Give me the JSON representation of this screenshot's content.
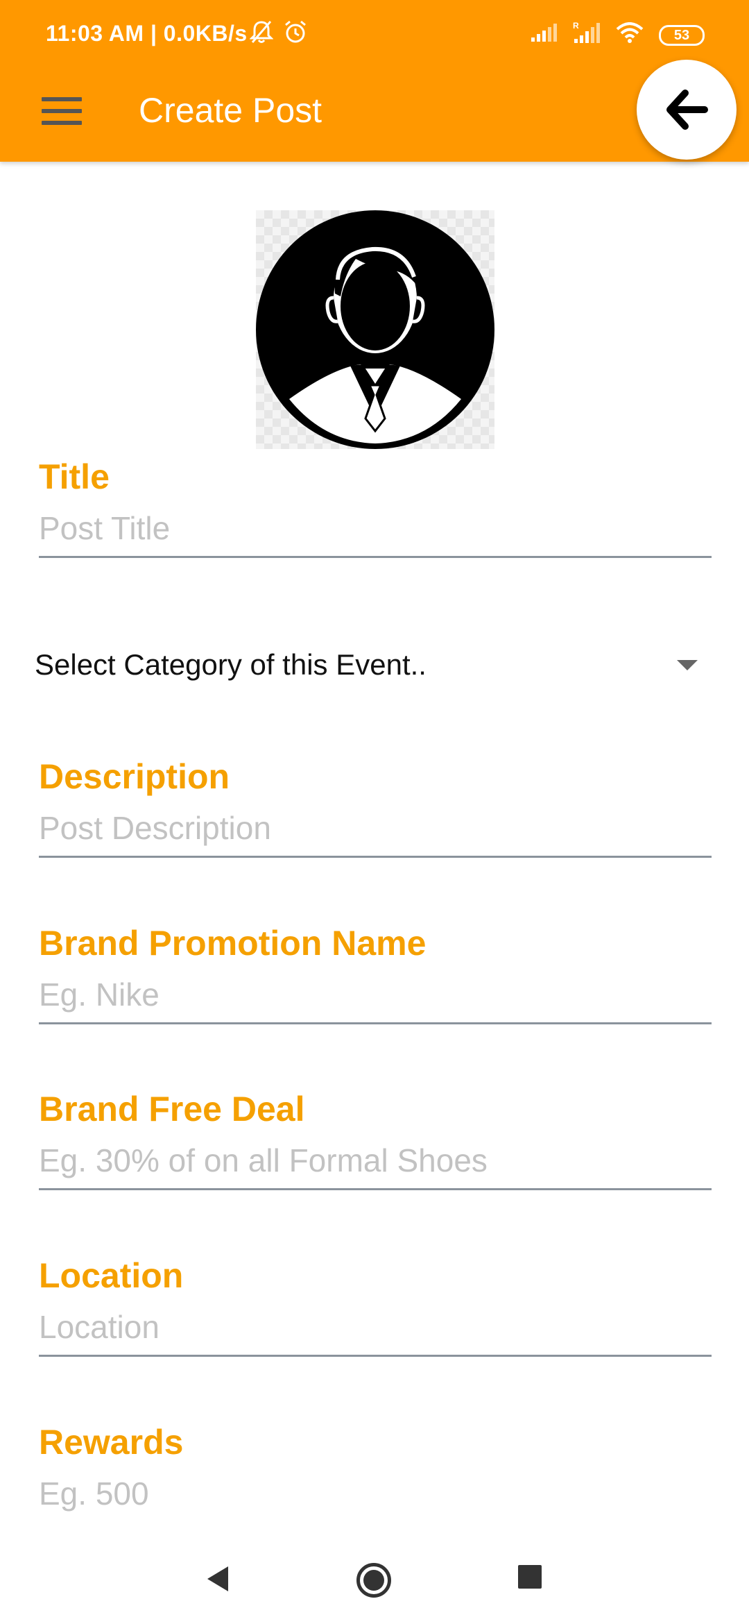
{
  "status_bar": {
    "time": "11:03 AM | 0.0KB/s",
    "battery": "53",
    "icons": [
      "bell-off-icon",
      "alarm-icon",
      "signal-icon",
      "signal-roaming-icon",
      "wifi-icon",
      "battery-icon"
    ]
  },
  "app_bar": {
    "title": "Create Post",
    "menu_icon": "hamburger-menu-icon",
    "back_icon": "arrow-left-icon"
  },
  "avatar": {
    "icon": "user-avatar-icon"
  },
  "form": {
    "title": {
      "label": "Title",
      "placeholder": "Post Title"
    },
    "category": {
      "selected": "Select Category of this Event.."
    },
    "description": {
      "label": "Description",
      "placeholder": "Post Description"
    },
    "brand_promotion": {
      "label": "Brand Promotion Name",
      "placeholder": "Eg. Nike"
    },
    "brand_deal": {
      "label": "Brand Free Deal",
      "placeholder": "Eg. 30% of on all Formal Shoes"
    },
    "location": {
      "label": "Location",
      "placeholder": "Location"
    },
    "rewards": {
      "label": "Rewards",
      "placeholder": "Eg. 500"
    }
  },
  "nav_bar": {
    "icons": [
      "nav-back-icon",
      "nav-home-icon",
      "nav-recents-icon"
    ]
  },
  "colors": {
    "primary": "#FF9800",
    "label": "#F5A000",
    "placeholder": "#C2C2C2",
    "underline": "#8A939C"
  }
}
